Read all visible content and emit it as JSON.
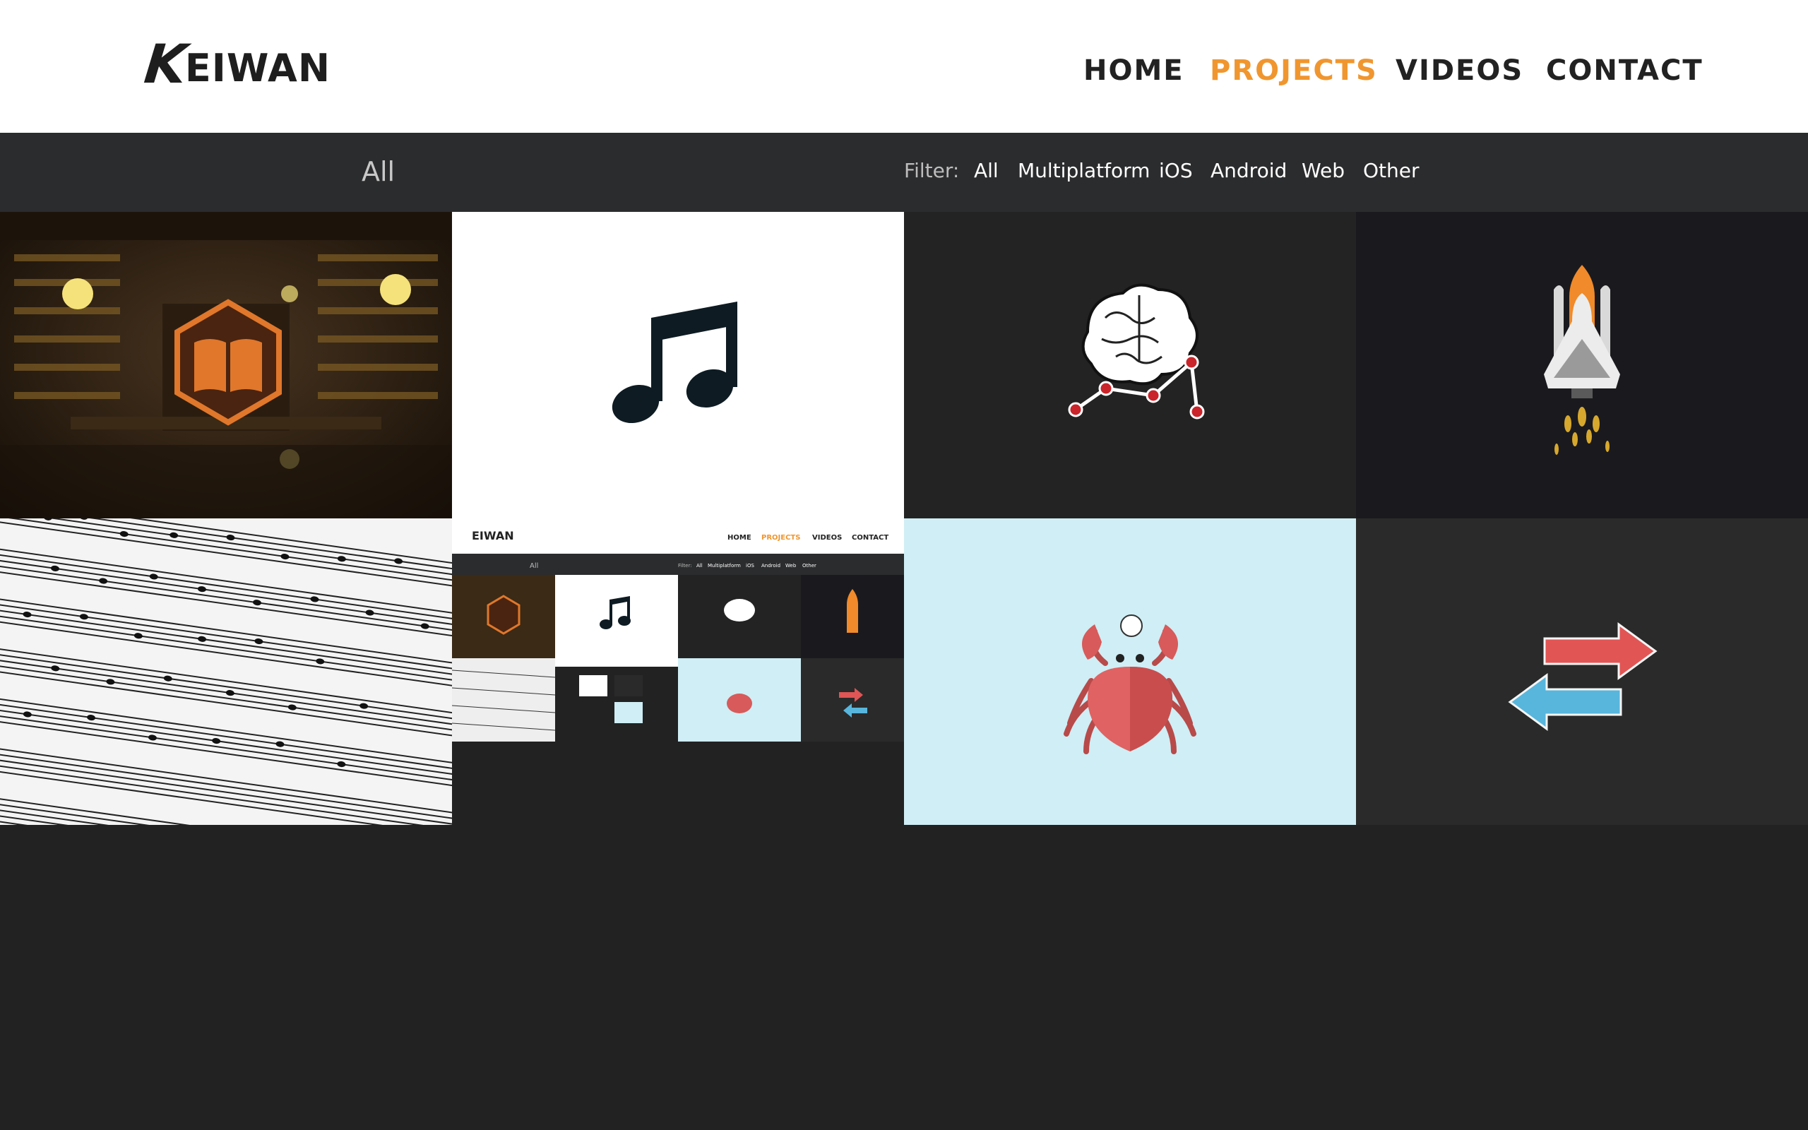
{
  "logo": {
    "initial": "K",
    "rest": "EIWAN"
  },
  "nav": {
    "items": [
      "HOME",
      "PROJECTS",
      "VIDEOS",
      "CONTACT"
    ],
    "active": "PROJECTS"
  },
  "filter": {
    "current": "All",
    "label": "Filter:",
    "options": [
      "All",
      "Multiplatform",
      "iOS",
      "Android",
      "Web",
      "Other"
    ]
  },
  "colors": {
    "accent": "#f0962f",
    "background": "#222222",
    "filterbar": "#2b2c2e"
  },
  "projects": [
    {
      "icon": "library-book-icon"
    },
    {
      "icon": "music-note-icon"
    },
    {
      "icon": "brain-graph-icon"
    },
    {
      "icon": "space-shuttle-icon"
    },
    {
      "icon": "sheet-music-image"
    },
    {
      "icon": "website-screenshot-image"
    },
    {
      "icon": "crab-icon"
    },
    {
      "icon": "swap-arrows-icon"
    }
  ],
  "mini": {
    "nav": [
      "HOME",
      "PROJECTS",
      "VIDEOS",
      "CONTACT"
    ],
    "current": "All",
    "filter": [
      "Filter:",
      "All",
      "Multiplatform",
      "iOS",
      "Android",
      "Web",
      "Other"
    ]
  }
}
